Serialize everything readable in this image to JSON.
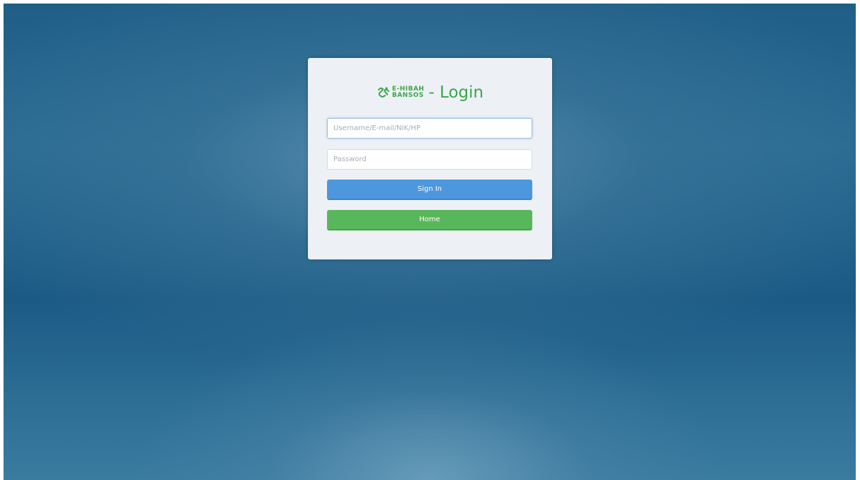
{
  "login": {
    "logo": {
      "line1": "E-HIBAH",
      "line2": "BANSOS",
      "icon": "handshake-logo-icon",
      "color": "#3aa64a"
    },
    "title": "- Login",
    "username": {
      "placeholder": "Username/E-mail/NIK/HP",
      "value": ""
    },
    "password": {
      "placeholder": "Password",
      "value": ""
    },
    "signin_label": "Sign In",
    "home_label": "Home"
  },
  "colors": {
    "background": "#23638c",
    "panel": "#edf1f6",
    "signin": "#4d97dd",
    "home": "#58b75a"
  }
}
